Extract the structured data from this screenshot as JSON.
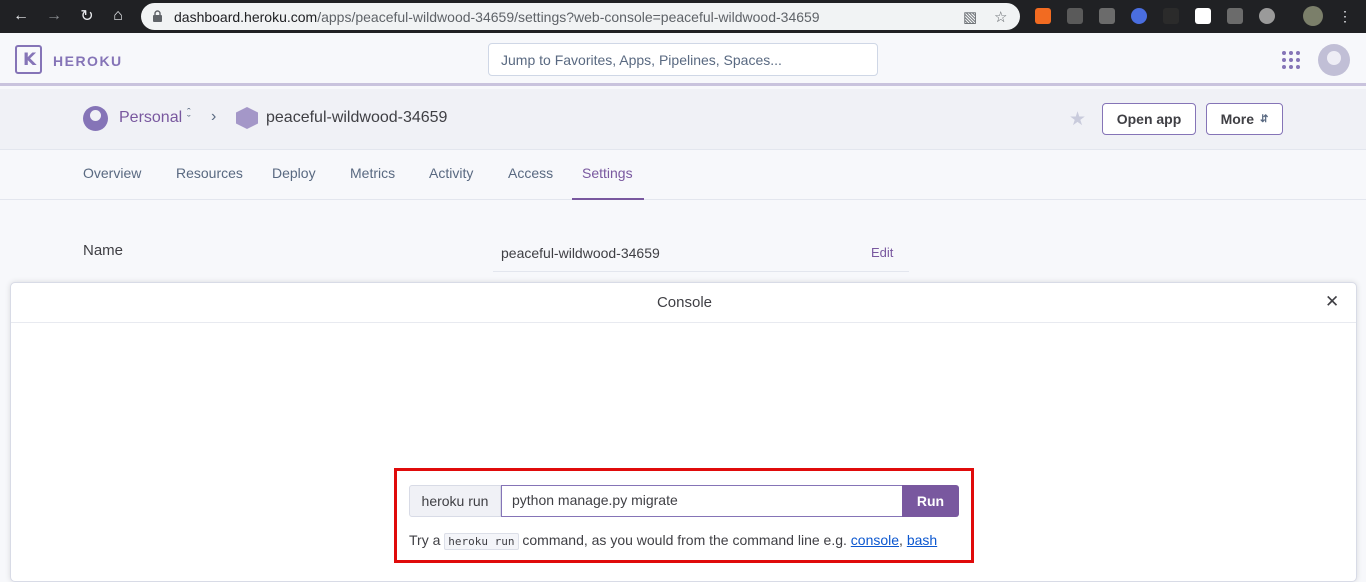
{
  "browser": {
    "url_host": "dashboard.heroku.com",
    "url_path": "/apps/peaceful-wildwood-34659/settings?web-console=peaceful-wildwood-34659",
    "extensions": [
      "ext-orange",
      "ext-card",
      "ext-i",
      "ext-check",
      "ext-braces",
      "ext-bookmark",
      "ext-i2",
      "ext-gear"
    ]
  },
  "header": {
    "brand": "HEROKU",
    "search_placeholder": "Jump to Favorites, Apps, Pipelines, Spaces..."
  },
  "appbar": {
    "account": "Personal",
    "app_name": "peaceful-wildwood-34659",
    "open_app": "Open app",
    "more": "More"
  },
  "tabs": [
    "Overview",
    "Resources",
    "Deploy",
    "Metrics",
    "Activity",
    "Access",
    "Settings"
  ],
  "active_tab": "Settings",
  "settings": {
    "name_label": "Name",
    "name_value": "peaceful-wildwood-34659",
    "edit": "Edit"
  },
  "console": {
    "title": "Console",
    "prefix": "heroku run",
    "command": "python manage.py migrate",
    "run_label": "Run",
    "hint_before": "Try a",
    "hint_code": "heroku run",
    "hint_middle": "command, as you would from the command line e.g.",
    "hint_link1": "console",
    "hint_link2": "bash"
  },
  "colors": {
    "accent": "#79589f",
    "highlight_border": "#e00b0b"
  }
}
